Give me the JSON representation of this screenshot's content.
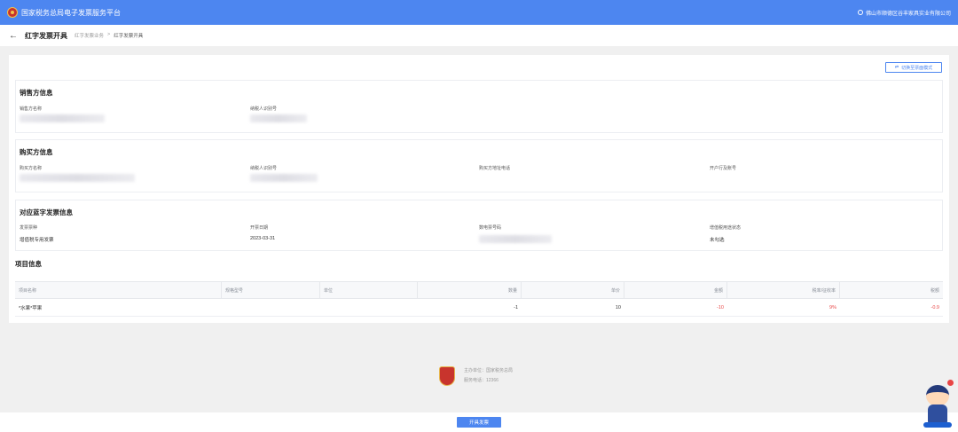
{
  "header": {
    "app_title": "国家税务总局电子发票服务平台",
    "user": "佛山市顺德区谷丰家具实业有限公司"
  },
  "nav": {
    "back_icon": "arrow-left-icon",
    "page_title": "红字发票开具",
    "breadcrumb": [
      "红字发票业务",
      ">",
      "红字发票开具"
    ]
  },
  "toolbar": {
    "switch_label": "切换至票面模式",
    "switch_icon": "swap-icon"
  },
  "seller": {
    "title": "销售方信息",
    "name_label": "销售方名称",
    "tax_id_label": "纳税人识别号"
  },
  "buyer": {
    "title": "购买方信息",
    "name_label": "购买方名称",
    "tax_id_label": "纳税人识别号",
    "address_label": "购买方地址电话",
    "bank_label": "开户行及账号"
  },
  "blue_invoice": {
    "title": "对应蓝字发票信息",
    "type_label": "发票票种",
    "type_value": "增值税专用发票",
    "date_label": "开票日期",
    "date_value": "2023-03-31",
    "number_label": "数电票号码",
    "usage_label": "增值税用途状态",
    "usage_value": "未勾选"
  },
  "items": {
    "title": "项目信息",
    "columns": [
      "项目名称",
      "规格型号",
      "单位",
      "数量",
      "单价",
      "金额",
      "税率/征收率",
      "税额"
    ],
    "rows": [
      [
        "*水果*苹果",
        "",
        "",
        "-1",
        "10",
        "-10",
        "9%",
        "-0.9"
      ]
    ]
  },
  "footer": {
    "sponsor": "主办单位：国家税务总局",
    "hotline": "服务电话：12366"
  },
  "actions": {
    "issue_label": "开具发票"
  },
  "colors": {
    "primary": "#4d86f0",
    "negative": "#e84545"
  }
}
